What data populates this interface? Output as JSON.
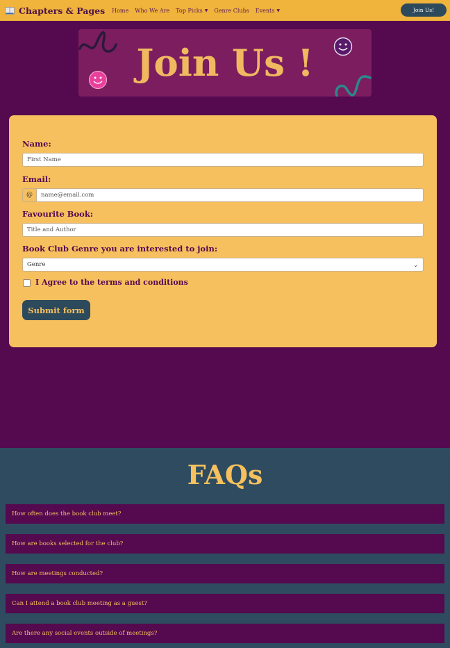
{
  "navbar": {
    "brand_icon": "open-book-icon",
    "brand": "Chapters & Pages",
    "links": [
      {
        "label": "Home"
      },
      {
        "label": "Who We Are"
      },
      {
        "label": "Top Picks",
        "dropdown": true
      },
      {
        "label": "Genre Clubs"
      },
      {
        "label": "Events",
        "dropdown": true
      }
    ],
    "join_label": "Join Us!"
  },
  "banner": {
    "title": "Join Us !",
    "decorations": [
      "smiley-face-icon",
      "squiggle-icon"
    ]
  },
  "form": {
    "name_label": "Name:",
    "name_placeholder": "First Name",
    "email_label": "Email:",
    "email_addon": "@",
    "email_placeholder": "name@email.com",
    "book_label": "Favourite Book:",
    "book_placeholder": "Title and Author",
    "genre_label": "Book Club Genre you are interested to join:",
    "genre_selected": "Genre",
    "agree_label": "I Agree to the terms and conditions",
    "submit_label": "Submit form"
  },
  "faq": {
    "title": "FAQs",
    "items": [
      {
        "question": "How often does the book club meet?"
      },
      {
        "question": "How are books selected for the club?"
      },
      {
        "question": "How are meetings conducted?"
      },
      {
        "question": "Can I attend a book club meeting as a guest?"
      },
      {
        "question": "Are there any social events outside of meetings?"
      }
    ]
  },
  "colors": {
    "page_background": "#55094f",
    "navbar": "#f0b33c",
    "banner": "#7c1d60",
    "form_card": "#f6c05e",
    "button": "#2d4a5c",
    "faq_background": "#2e4b5f",
    "accent_pink": "#e8409c",
    "accent_teal": "#2a8a8a"
  }
}
